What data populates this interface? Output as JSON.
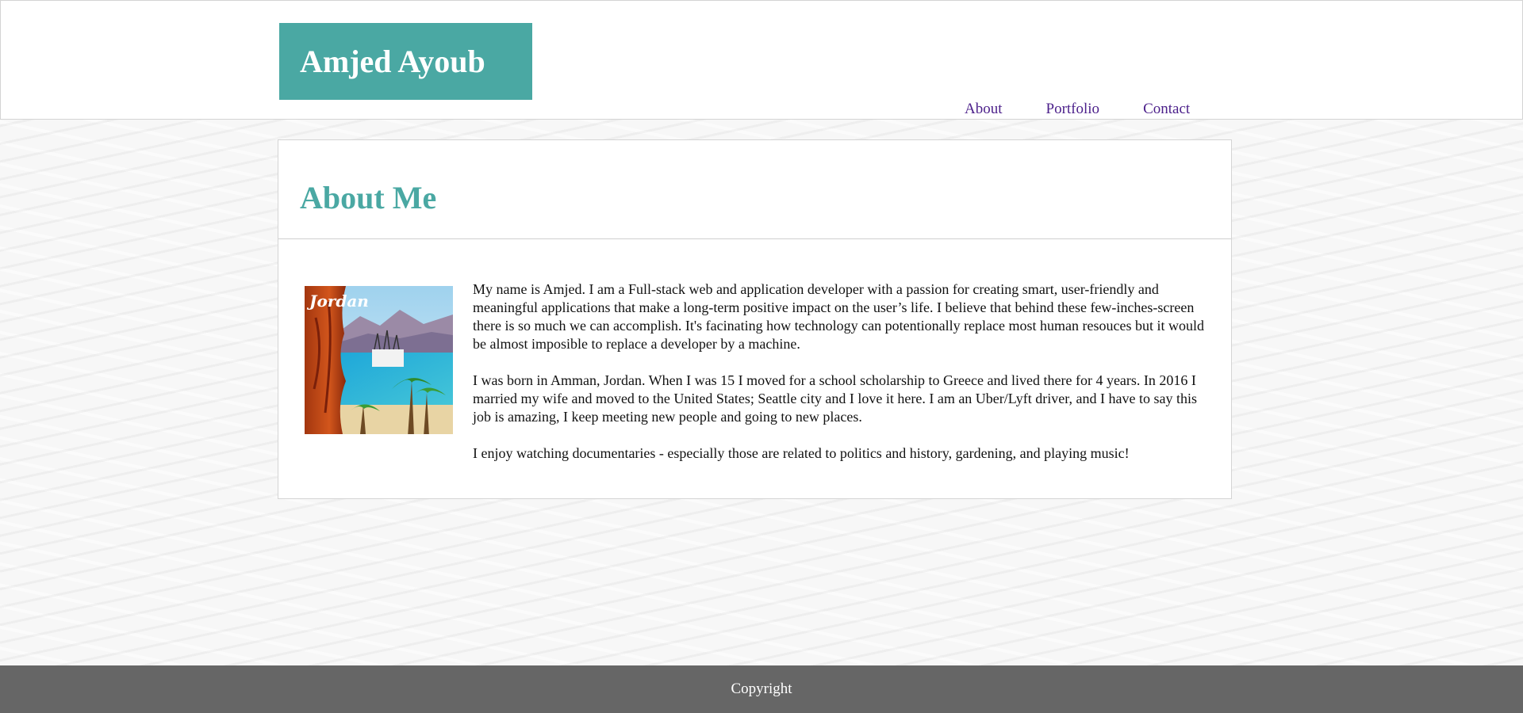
{
  "header": {
    "site_title": "Amjed Ayoub",
    "nav": [
      {
        "label": "About"
      },
      {
        "label": "Portfolio"
      },
      {
        "label": "Contact"
      }
    ]
  },
  "about": {
    "title": "About Me",
    "photo_caption": "Jordan",
    "paragraphs": [
      "My name is Amjed. I am a Full-stack web and application developer with a passion for creating smart, user-friendly and meaningful applications that make a long-term positive impact on the user’s life. I believe that behind these few-inches-screen there is so much we can accomplish. It's facinating how technology can potentionally replace most human resouces but it would be almost imposible to replace a developer by a machine.",
      "I was born in Amman, Jordan. When I was 15 I moved for a school scholarship to Greece and lived there for 4 years. In 2016 I married my wife and moved to the United States; Seattle city and I love it here. I am an Uber/Lyft driver, and I have to say this job is amazing, I keep meeting new people and going to new places.",
      "I enjoy watching documentaries - especially those are related to politics and history, gardening, and playing music!"
    ]
  },
  "footer": {
    "text": "Copyright"
  },
  "colors": {
    "accent": "#4aa8a3",
    "nav_link": "#4b1f8a",
    "footer_bg": "#666666"
  }
}
